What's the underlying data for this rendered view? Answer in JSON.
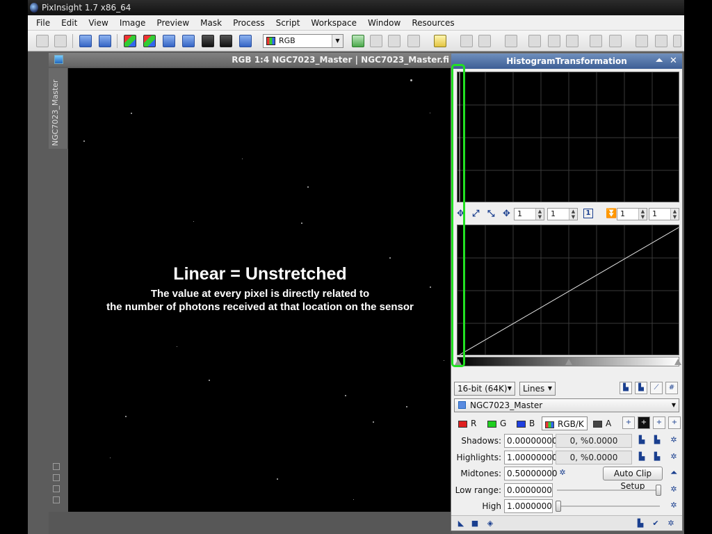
{
  "window": {
    "title": "PixInsight 1.7 x86_64"
  },
  "menu": [
    "File",
    "Edit",
    "View",
    "Image",
    "Preview",
    "Mask",
    "Process",
    "Script",
    "Workspace",
    "Window",
    "Resources"
  ],
  "toolbar": {
    "rgb_select": "RGB"
  },
  "image_window": {
    "title": "RGB 1:4 NGC7023_Master | NGC7023_Master.fi",
    "side_tab": "NGC7023_Master"
  },
  "overlay": {
    "title": "Linear = Unstretched",
    "line1": "The value at every pixel is directly related to",
    "line2": "the number of photons received at that location on the sensor"
  },
  "histogram": {
    "title": "HistogramTransformation",
    "zoom_x": "1",
    "zoom_y": "1",
    "zoom_x2": "1",
    "zoom_y2": "1",
    "frame_label": "1",
    "depth": "16-bit (64K)",
    "graph_style": "Lines",
    "view": "NGC7023_Master",
    "channels": [
      {
        "label": "R",
        "color": "#e02020"
      },
      {
        "label": "G",
        "color": "#20d020"
      },
      {
        "label": "B",
        "color": "#2040e0"
      },
      {
        "label": "RGB/K",
        "color": "#aaaaaa"
      },
      {
        "label": "A",
        "color": "#444444"
      }
    ],
    "shadows_label": "Shadows:",
    "shadows": "0.00000000",
    "shadows_clip": "0, %0.0000",
    "highlights_label": "Highlights:",
    "highlights": "1.00000000",
    "highlights_clip": "0, %0.0000",
    "midtones_label": "Midtones:",
    "midtones": "0.50000000",
    "auto_clip": "Auto Clip Setup",
    "low_range_label": "Low range:",
    "low_range": "0.0000000",
    "high_range_label": "High range:",
    "high_range": "1.0000000"
  },
  "colors": {
    "accent": "#22e022",
    "panel_header": "#4d6fa6"
  }
}
